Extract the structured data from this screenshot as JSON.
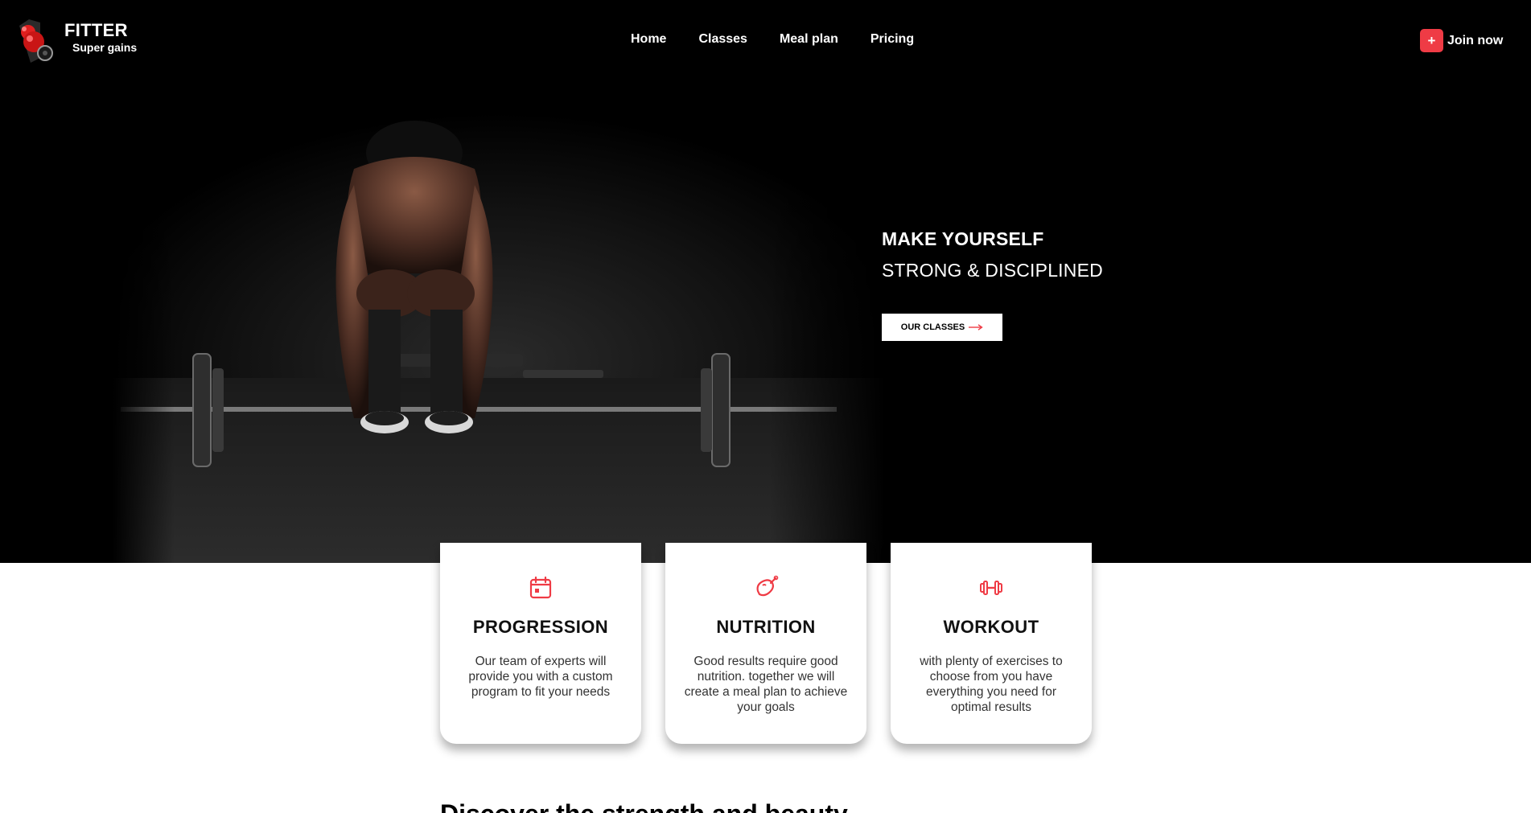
{
  "brand": {
    "name": "FITTER",
    "tagline": "Super gains"
  },
  "nav": {
    "items": [
      {
        "label": "Home"
      },
      {
        "label": "Classes"
      },
      {
        "label": "Meal plan"
      },
      {
        "label": "Pricing"
      }
    ],
    "cta": {
      "icon": "plus-icon",
      "plus": "+",
      "label": "Join now"
    }
  },
  "hero": {
    "headline": "MAKE YOURSELF",
    "subheadline": "STRONG & DISCIPLINED",
    "button": {
      "label": "OUR CLASSES",
      "icon": "arrow-right-icon"
    }
  },
  "features": [
    {
      "icon": "calendar-icon",
      "title": "PROGRESSION",
      "text": "Our team of experts will provide you with a custom program to fit your needs"
    },
    {
      "icon": "meat-leg-icon",
      "title": "NUTRITION",
      "text": "Good results require good nutrition. together we will create a meal plan to achieve your goals"
    },
    {
      "icon": "dumbbell-icon",
      "title": "WORKOUT",
      "text": "with plenty of exercises to choose from you have everything you need for optimal results"
    }
  ],
  "next_section": {
    "title": "Discover the strength and beauty"
  },
  "colors": {
    "accent": "#ef3b45",
    "hero_bg": "#000000",
    "text_dark": "#111111"
  }
}
